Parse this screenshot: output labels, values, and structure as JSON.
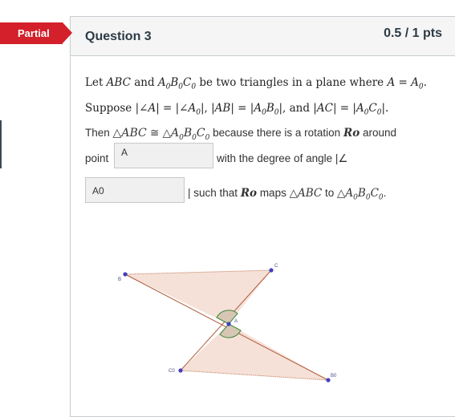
{
  "badge": {
    "label": "Partial",
    "color": "#d3202a"
  },
  "question": {
    "title": "Question 3",
    "points": "0.5 / 1 pts"
  },
  "statement": {
    "line1": "Let ABC and A₀B₀C₀ be two triangles in a plane where A = A₀.",
    "line2": "Suppose |∠A| = |∠A₀|, |AB| = |A₀B₀|,  and |AC| = |A₀C₀|.",
    "line3_prefix": "Then",
    "line3_math": "△ABC ≅ △A₀B₀C₀",
    "line3_mid": "because there is a rotation",
    "line3_ro": "Ro",
    "line3_suffix": "around",
    "line4_prefix": "point",
    "line4_after": "with the degree of angle |∠",
    "line5_after": "| such that",
    "line5_ro": "Ro",
    "line5_maps": "maps",
    "line5_tri1": "△ABC",
    "line5_to": "to",
    "line5_tri2": "△A₀B₀C₀",
    "line5_end": "."
  },
  "answers": {
    "box1_value": "A",
    "box2_value": "A0"
  },
  "figure": {
    "points": {
      "B": "B",
      "C": "C",
      "A": "A",
      "C0": "C0",
      "B0": "B0"
    },
    "fill_color": "#f5e1d8",
    "edge_color": "#b05a3a",
    "angle_color": "#3e8a3e",
    "point_color": "#4040c0"
  }
}
